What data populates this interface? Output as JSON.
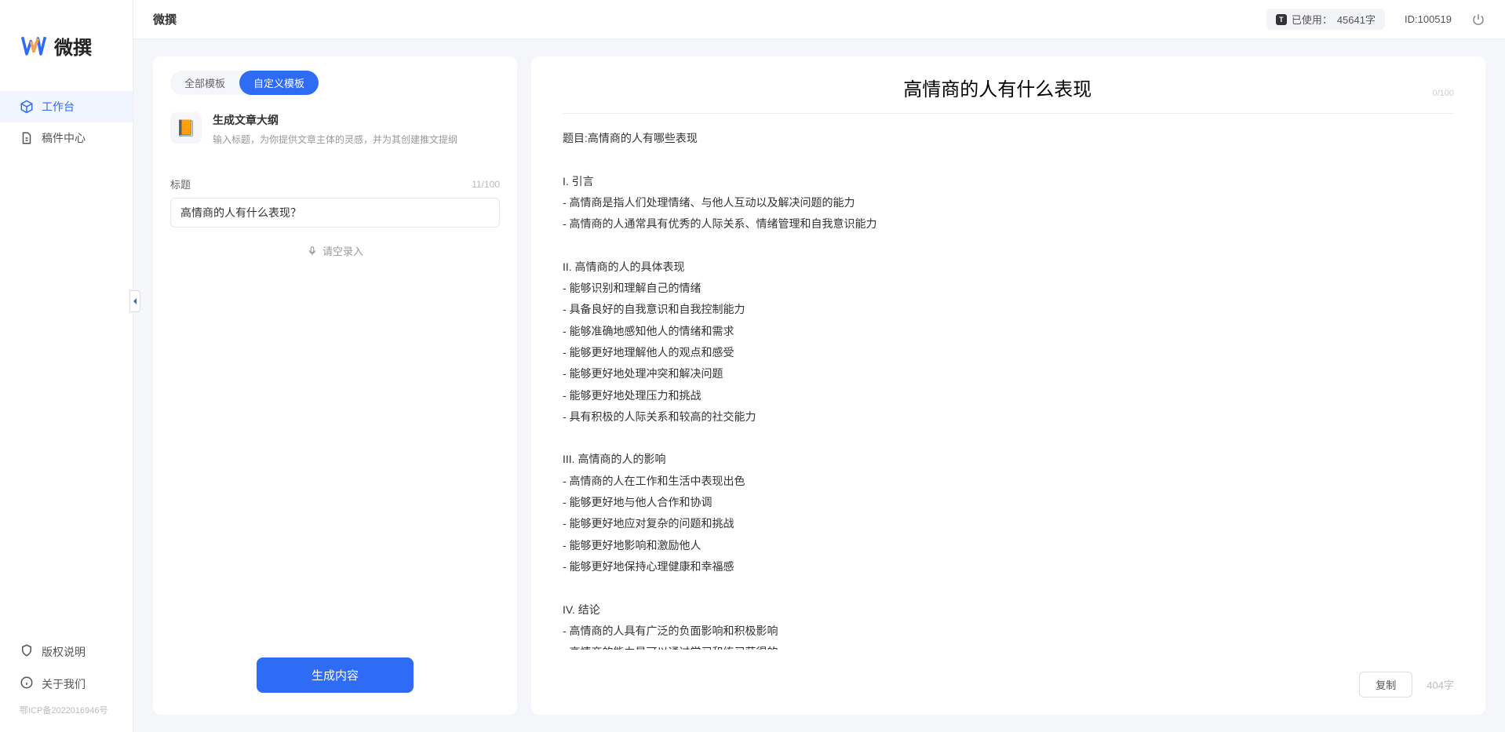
{
  "app": {
    "name": "微撰",
    "logo_text": "微撰"
  },
  "sidebar": {
    "nav": [
      {
        "label": "工作台",
        "icon": "cube",
        "active": true
      },
      {
        "label": "稿件中心",
        "icon": "doc",
        "active": false
      }
    ],
    "bottom": [
      {
        "label": "版权说明",
        "icon": "shield"
      },
      {
        "label": "关于我们",
        "icon": "info"
      }
    ],
    "icp": "鄂ICP备2022016946号"
  },
  "topbar": {
    "title": "微撰",
    "usage_label": "已使用：",
    "usage_value": "45641字",
    "user_id_label": "ID:",
    "user_id": "100519"
  },
  "tabs": [
    {
      "label": "全部模板",
      "active": false
    },
    {
      "label": "自定义模板",
      "active": true
    }
  ],
  "template": {
    "icon": "📙",
    "title": "生成文章大纲",
    "desc": "输入标题，为你提供文章主体的灵感，并为其创建推文提纲"
  },
  "form": {
    "title_label": "标题",
    "title_count": "11/100",
    "title_value": "高情商的人有什么表现？",
    "voice_label": "请空录入"
  },
  "generate_button": "生成内容",
  "output": {
    "title": "高情商的人有什么表现",
    "top_count": "0/100",
    "body": "题目:高情商的人有哪些表现\n\nI. 引言\n- 高情商是指人们处理情绪、与他人互动以及解决问题的能力\n- 高情商的人通常具有优秀的人际关系、情绪管理和自我意识能力\n\nII. 高情商的人的具体表现\n- 能够识别和理解自己的情绪\n- 具备良好的自我意识和自我控制能力\n- 能够准确地感知他人的情绪和需求\n- 能够更好地理解他人的观点和感受\n- 能够更好地处理冲突和解决问题\n- 能够更好地处理压力和挑战\n- 具有积极的人际关系和较高的社交能力\n\nIII. 高情商的人的影响\n- 高情商的人在工作和生活中表现出色\n- 能够更好地与他人合作和协调\n- 能够更好地应对复杂的问题和挑战\n- 能够更好地影响和激励他人\n- 能够更好地保持心理健康和幸福感\n\nIV. 结论\n- 高情商的人具有广泛的负面影响和积极影响\n- 高情商的能力是可以通过学习和练习获得的\n- 培养和提高高情商的能力对于个人的职业发展和生活质量至关重要。",
    "copy_button": "复制",
    "word_count": "404字"
  }
}
